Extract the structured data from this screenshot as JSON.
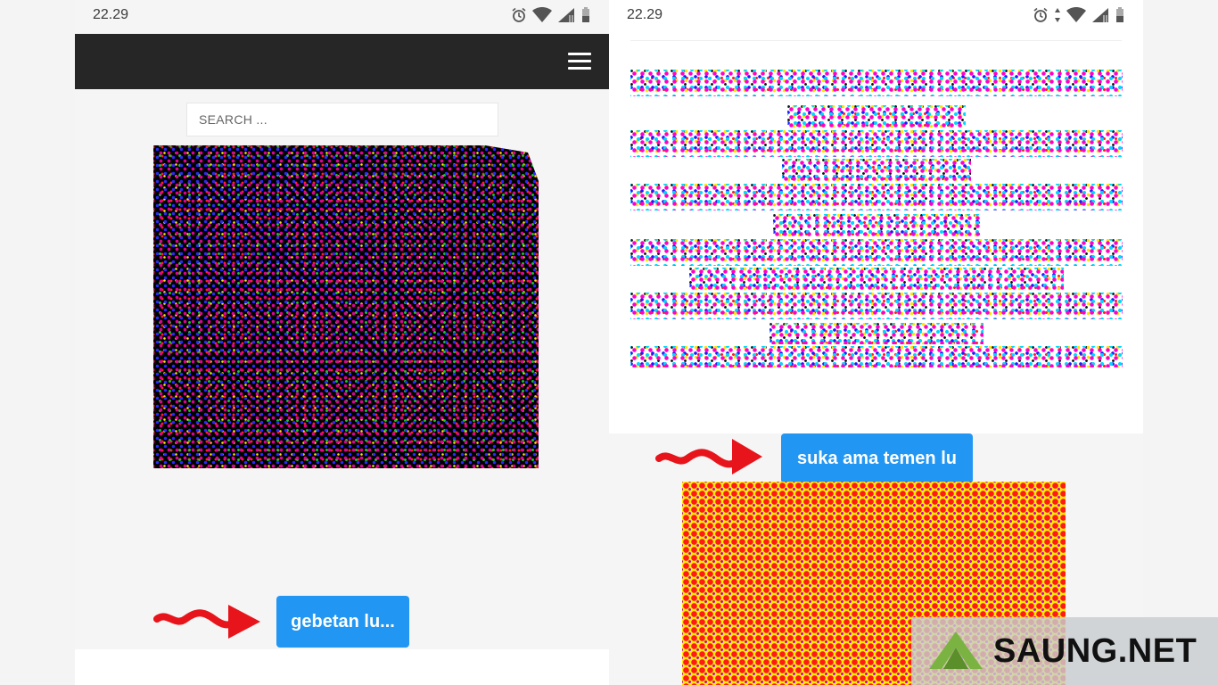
{
  "left_screen": {
    "status_bar": {
      "time": "22.29",
      "icons": [
        "alarm-icon",
        "wifi-icon",
        "signal-icon",
        "battery-icon"
      ]
    },
    "navbar": {
      "menu_icon": "hamburger-menu-icon",
      "background": "#262626"
    },
    "search": {
      "placeholder": "SEARCH ..."
    },
    "label": "gebetan lu..."
  },
  "right_screen": {
    "status_bar": {
      "time": "22.29",
      "icons": [
        "alarm-icon",
        "data-arrows-icon",
        "wifi-icon",
        "signal-icon",
        "battery-icon"
      ]
    },
    "label": "suka ama temen lu"
  },
  "watermark": {
    "text": "SAUNG.NET",
    "logo_icon": "saung-roof-logo-icon"
  },
  "colors": {
    "accent": "#2196f3",
    "arrow": "#e8141b",
    "navbar": "#262626"
  }
}
